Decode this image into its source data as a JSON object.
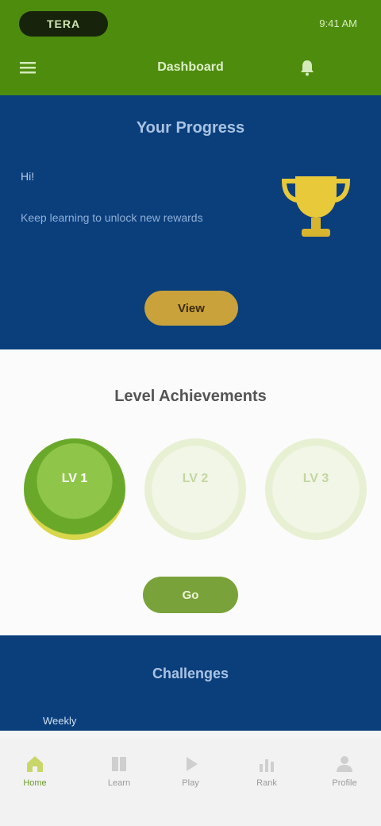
{
  "header": {
    "logo": "TERA",
    "status": "9:41 AM",
    "title": "Dashboard",
    "colors": {
      "bar": "#4e8c0e"
    }
  },
  "hero": {
    "title": "Your Progress",
    "label": "Hi!",
    "text": "Keep learning to unlock new rewards",
    "button": "View",
    "colors": {
      "background": "#0b3f7c",
      "accent": "#c9a23b"
    }
  },
  "levels": {
    "title": "Level Achievements",
    "badges": [
      {
        "label": "LV 1",
        "state": "unlocked"
      },
      {
        "label": "LV 2",
        "state": "locked"
      },
      {
        "label": "LV 3",
        "state": "locked"
      }
    ],
    "button": "Go",
    "colors": {
      "accent": "#7aa23a"
    }
  },
  "bottom": {
    "title": "Challenges",
    "subtitle": "Weekly"
  },
  "tabs": [
    {
      "label": "Home",
      "icon": "home-icon",
      "active": true
    },
    {
      "label": "Learn",
      "icon": "book-icon",
      "active": false
    },
    {
      "label": "Play",
      "icon": "play-icon",
      "active": false
    },
    {
      "label": "Rank",
      "icon": "chart-icon",
      "active": false
    },
    {
      "label": "Profile",
      "icon": "user-icon",
      "active": false
    }
  ]
}
